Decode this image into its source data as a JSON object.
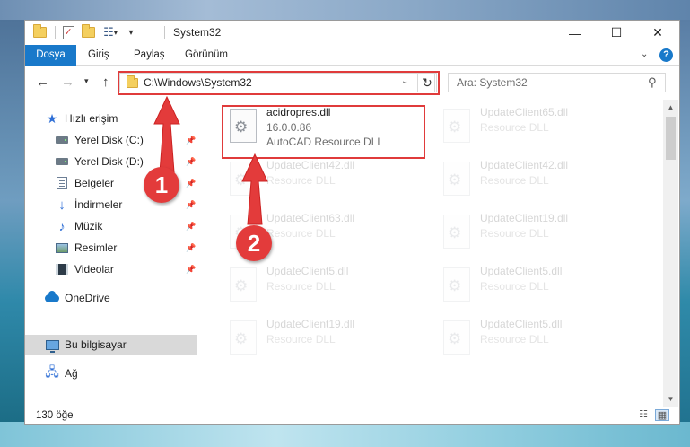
{
  "window": {
    "title": "System32",
    "buttons": {
      "minimize": "—",
      "maximize": "☐",
      "close": "✕"
    }
  },
  "ribbon": {
    "tabs": [
      "Dosya",
      "Giriş",
      "Paylaş",
      "Görünüm"
    ],
    "help": "?"
  },
  "address": {
    "path": "C:\\Windows\\System32",
    "search_placeholder": "Ara: System32"
  },
  "nav": {
    "items": [
      {
        "label": "Hızlı erişim",
        "icon": "star-icon"
      },
      {
        "label": "Yerel Disk (C:)",
        "icon": "drive-icon",
        "pinned": true
      },
      {
        "label": "Yerel Disk (D:)",
        "icon": "drive-icon",
        "pinned": true
      },
      {
        "label": "Belgeler",
        "icon": "documents-icon",
        "pinned": true
      },
      {
        "label": "İndirmeler",
        "icon": "download-icon",
        "pinned": true
      },
      {
        "label": "Müzik",
        "icon": "music-icon",
        "pinned": true
      },
      {
        "label": "Resimler",
        "icon": "pictures-icon",
        "pinned": true
      },
      {
        "label": "Videolar",
        "icon": "videos-icon",
        "pinned": true
      },
      {
        "label": "OneDrive",
        "icon": "onedrive-icon"
      },
      {
        "label": "Bu bilgisayar",
        "icon": "this-pc-icon",
        "selected": true
      },
      {
        "label": "Ağ",
        "icon": "network-icon"
      }
    ]
  },
  "files": [
    {
      "name": "acidropres.dll",
      "version": "16.0.0.86",
      "description": "AutoCAD  Resource DLL",
      "highlighted": true
    },
    {
      "name": "UpdateClient65.dll",
      "description": "Resource DLL"
    },
    {
      "name": "UpdateClient42.dll",
      "description": "Resource DLL"
    },
    {
      "name": "UpdateClient42.dll",
      "description": "Resource DLL"
    },
    {
      "name": "UpdateClient63.dll",
      "description": "Resource DLL"
    },
    {
      "name": "UpdateClient19.dll",
      "description": "Resource DLL"
    },
    {
      "name": "UpdateClient5.dll",
      "description": "Resource DLL"
    },
    {
      "name": "UpdateClient5.dll",
      "description": "Resource DLL"
    },
    {
      "name": "UpdateClient19.dll",
      "description": "Resource DLL"
    },
    {
      "name": "UpdateClient5.dll",
      "description": "Resource DLL"
    }
  ],
  "status": {
    "count": "130 öğe"
  },
  "annotations": {
    "step1": "1",
    "step2": "2"
  },
  "colors": {
    "accent": "#1979ca",
    "highlight": "#e03b3b"
  }
}
